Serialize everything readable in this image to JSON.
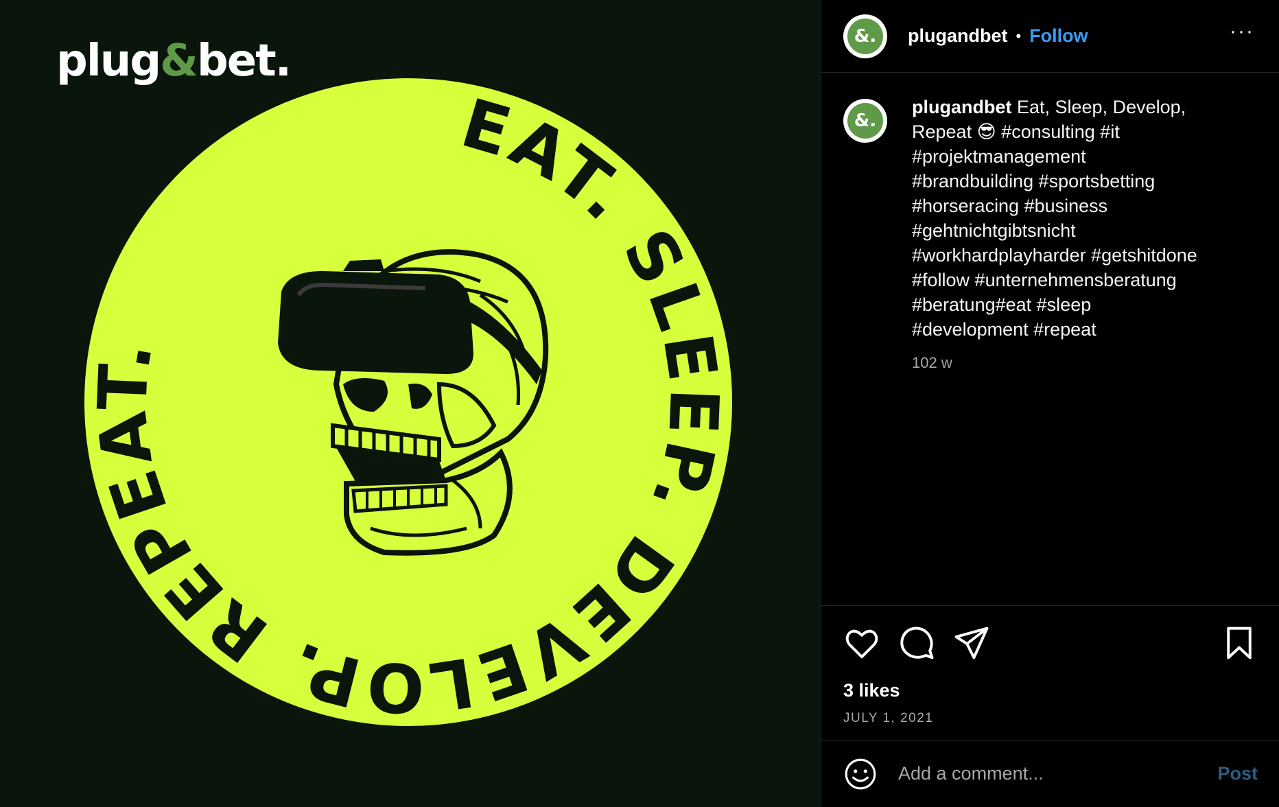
{
  "media": {
    "brand_prefix": "plug",
    "brand_amp": "&",
    "brand_suffix": "bet.",
    "badge_ring_text": "EAT. SLEEP. DEVELOP. REPEAT.",
    "badge_color": "#d7ff3c",
    "background_color": "#0a150b",
    "center_graphic": "skull-with-vr-headset"
  },
  "header": {
    "avatar_glyph": "&.",
    "username": "plugandbet",
    "separator": "•",
    "follow_label": "Follow",
    "more_label": "···"
  },
  "caption": {
    "avatar_glyph": "&.",
    "username": "plugandbet",
    "text": " Eat, Sleep, Develop,\nRepeat 😎 #consulting #it\n#projektmanagement\n#brandbuilding #sportsbetting\n#horseracing #business\n#gehtnichtgibtsnicht\n#workhardplayharder #getshitdone\n#follow #unternehmensberatung\n#beratung#eat #sleep\n#development #repeat",
    "timestamp": "102 w"
  },
  "actions": {
    "like_icon": "heart-icon",
    "comment_icon": "comment-icon",
    "share_icon": "paper-plane-icon",
    "save_icon": "bookmark-icon",
    "likes": "3 likes",
    "date": "JULY 1, 2021"
  },
  "comment": {
    "emoji_icon": "smiley-icon",
    "placeholder": "Add a comment...",
    "post_label": "Post"
  },
  "colors": {
    "accent": "#3a9cf5",
    "brand_green": "#5e9a47",
    "badge_yellow": "#d7ff3c"
  }
}
